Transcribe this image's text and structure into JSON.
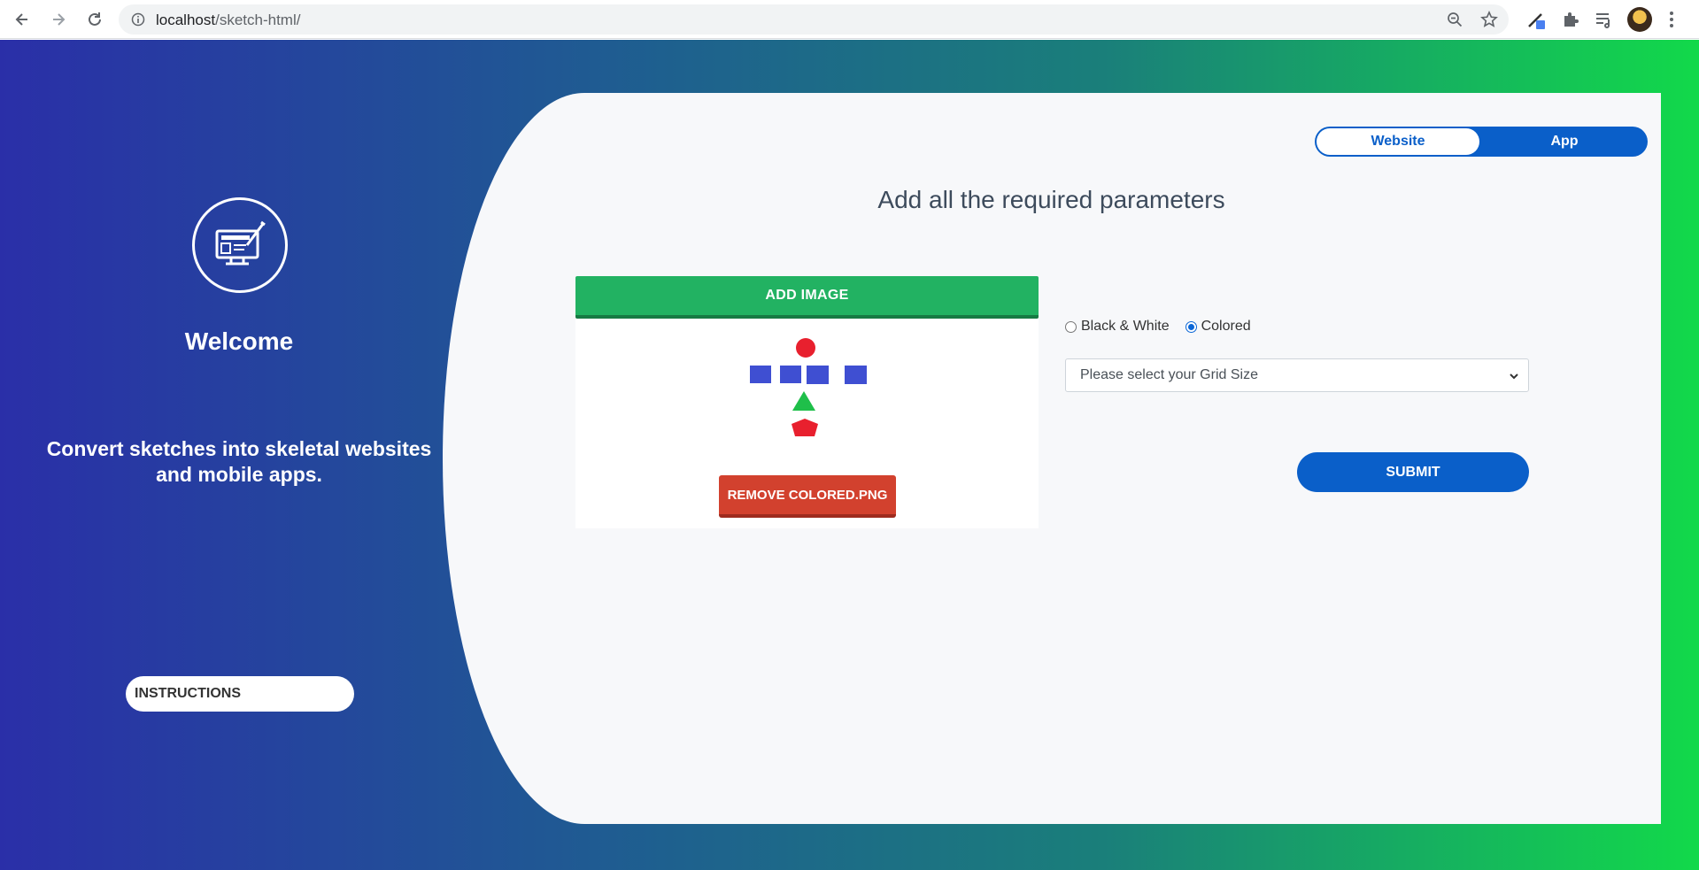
{
  "browser": {
    "url_host": "localhost",
    "url_path": "/sketch-html/"
  },
  "sidebar": {
    "welcome": "Welcome",
    "tagline": "Convert sketches into skeletal websites and mobile apps.",
    "instructions_label": "INSTRUCTIONS"
  },
  "toggle": {
    "website_label": "Website",
    "app_label": "App",
    "selected": "Website"
  },
  "main": {
    "heading": "Add all the required parameters",
    "add_image_label": "ADD IMAGE",
    "remove_label": "REMOVE COLORED.PNG",
    "radio_bw_label": "Black & White",
    "radio_colored_label": "Colored",
    "radio_selected": "Colored",
    "grid_select_placeholder": "Please select your Grid Size",
    "submit_label": "SUBMIT"
  },
  "colors": {
    "primary_blue": "#0a5fc9",
    "add_image_green": "#22b262",
    "remove_red": "#d2412e",
    "shape_red": "#e8202e",
    "shape_blue": "#3f4fd2",
    "shape_green": "#1fbf4a"
  },
  "icons": [
    "back-icon",
    "forward-icon",
    "reload-icon",
    "info-icon",
    "zoom-icon",
    "star-icon",
    "eyedropper-extension-icon",
    "puzzle-extension-icon",
    "reading-list-icon",
    "avatar",
    "menu-dots-icon",
    "monitor-pen-logo-icon",
    "chevron-down-icon"
  ]
}
